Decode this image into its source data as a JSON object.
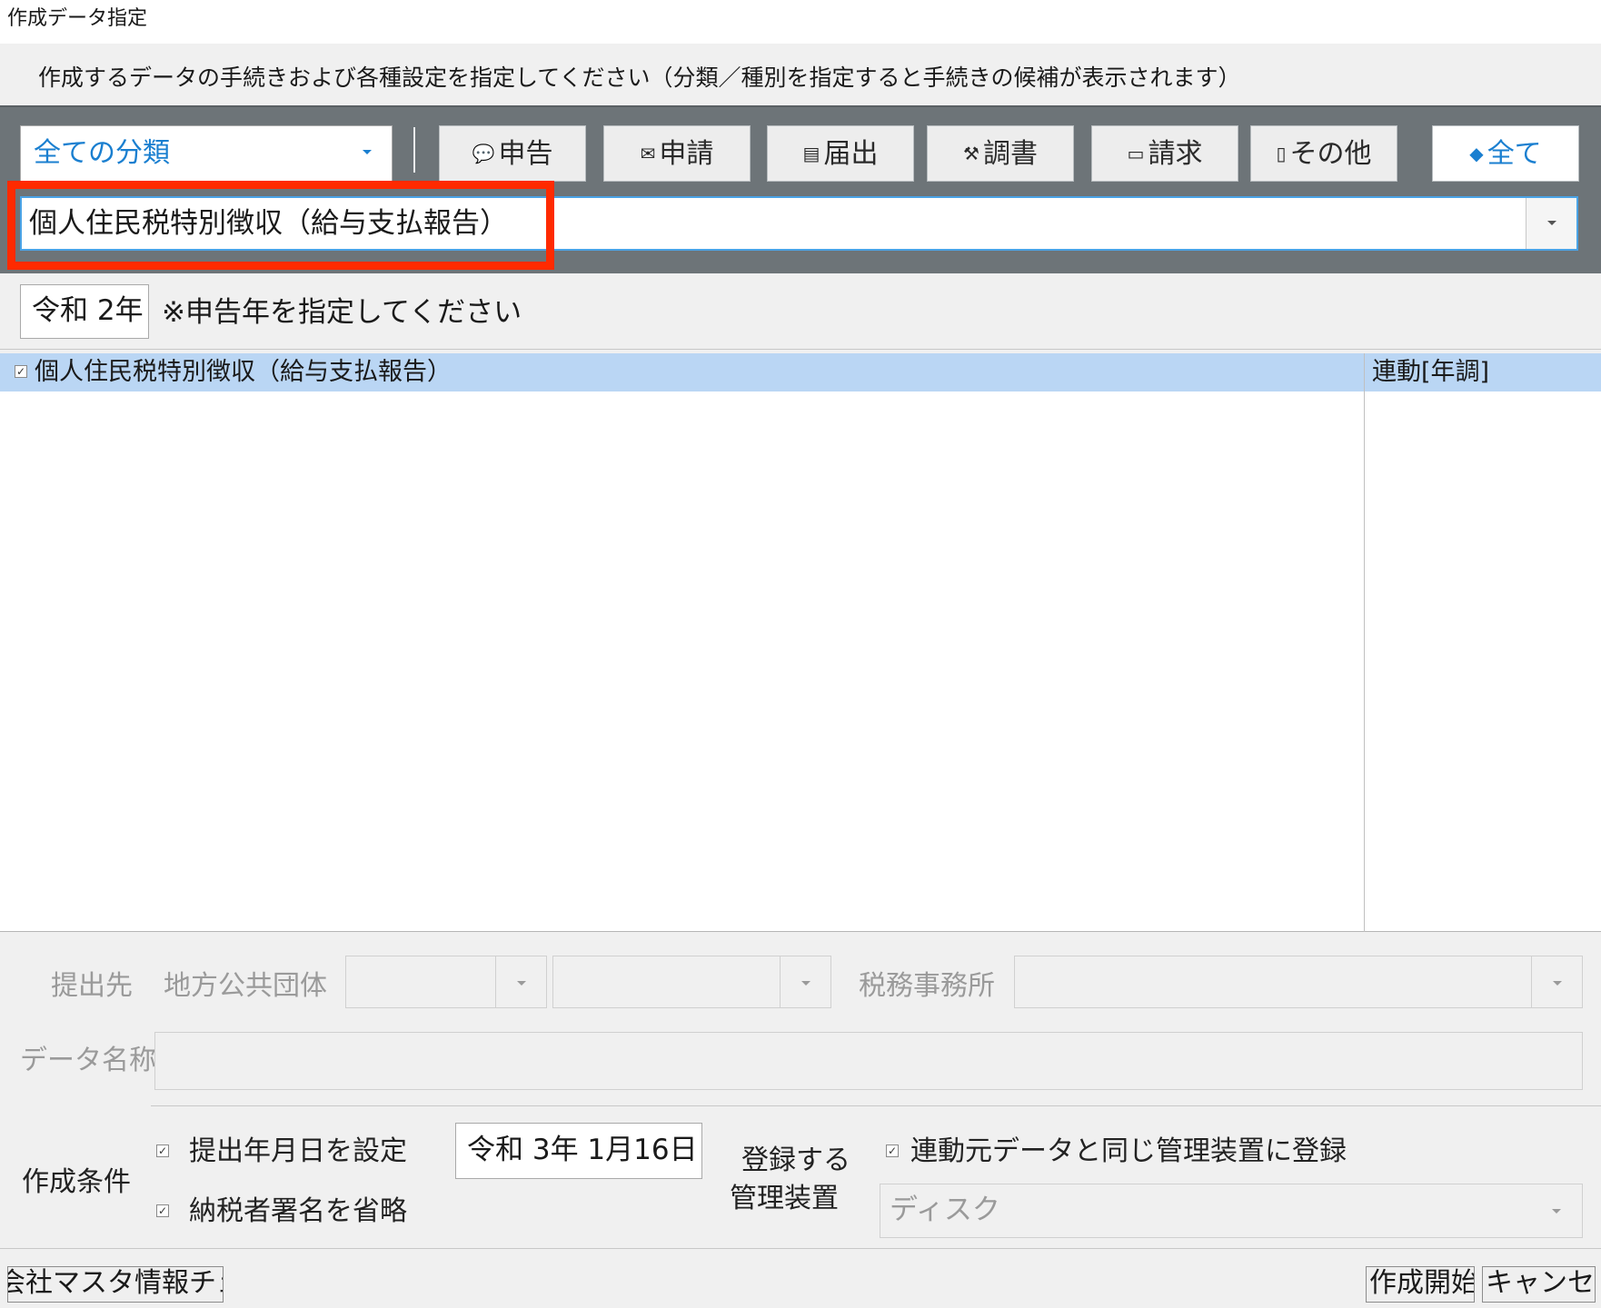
{
  "window": {
    "title": "作成データ指定"
  },
  "instructions": "作成するデータの手続きおよび各種設定を指定してください（分類／種別を指定すると手続きの候補が表示されます）",
  "filter": {
    "category_value": "全ての分類",
    "buttons": [
      {
        "id": "shinkoku",
        "label": "申告",
        "icon": "tax-bubble-icon"
      },
      {
        "id": "shinsei",
        "label": "申請",
        "icon": "stamp-icon"
      },
      {
        "id": "todokede",
        "label": "届出",
        "icon": "document-icon"
      },
      {
        "id": "chosho",
        "label": "調書",
        "icon": "gavel-icon"
      },
      {
        "id": "seikyu",
        "label": "請求",
        "icon": "money-icon"
      },
      {
        "id": "sonota",
        "label": "その他",
        "icon": "page-icon"
      },
      {
        "id": "subete",
        "label": "全て",
        "icon": "layers-icon"
      }
    ],
    "procedure_value": "個人住民税特別徴収（給与支払報告）"
  },
  "year": {
    "value": "令和 2年",
    "note": "※申告年を指定してください"
  },
  "list": {
    "rows": [
      {
        "checked": true,
        "name": "個人住民税特別徴収（給与支払報告）",
        "col2": "連動[年調]"
      }
    ]
  },
  "form": {
    "teishutsusaki_label": "提出先",
    "chiho_label": "地方公共団体",
    "zeimu_label": "税務事務所",
    "data_name_label": "データ名称",
    "conditions_label": "作成条件",
    "cond1_label": "提出年月日を設定",
    "cond1_checked": true,
    "cond2_label": "納税者署名を省略",
    "cond2_checked": true,
    "date_value": "令和 3年 1月16日",
    "register_label_line1": "登録する",
    "register_label_line2": "管理装置",
    "register_same_label": "連動元データと同じ管理装置に登録",
    "register_same_checked": true,
    "device_value": "ディスク"
  },
  "footer": {
    "master_check_label": "会社マスタ情報チェック",
    "start_label": "作成開始",
    "cancel_label": "キャンセル"
  }
}
